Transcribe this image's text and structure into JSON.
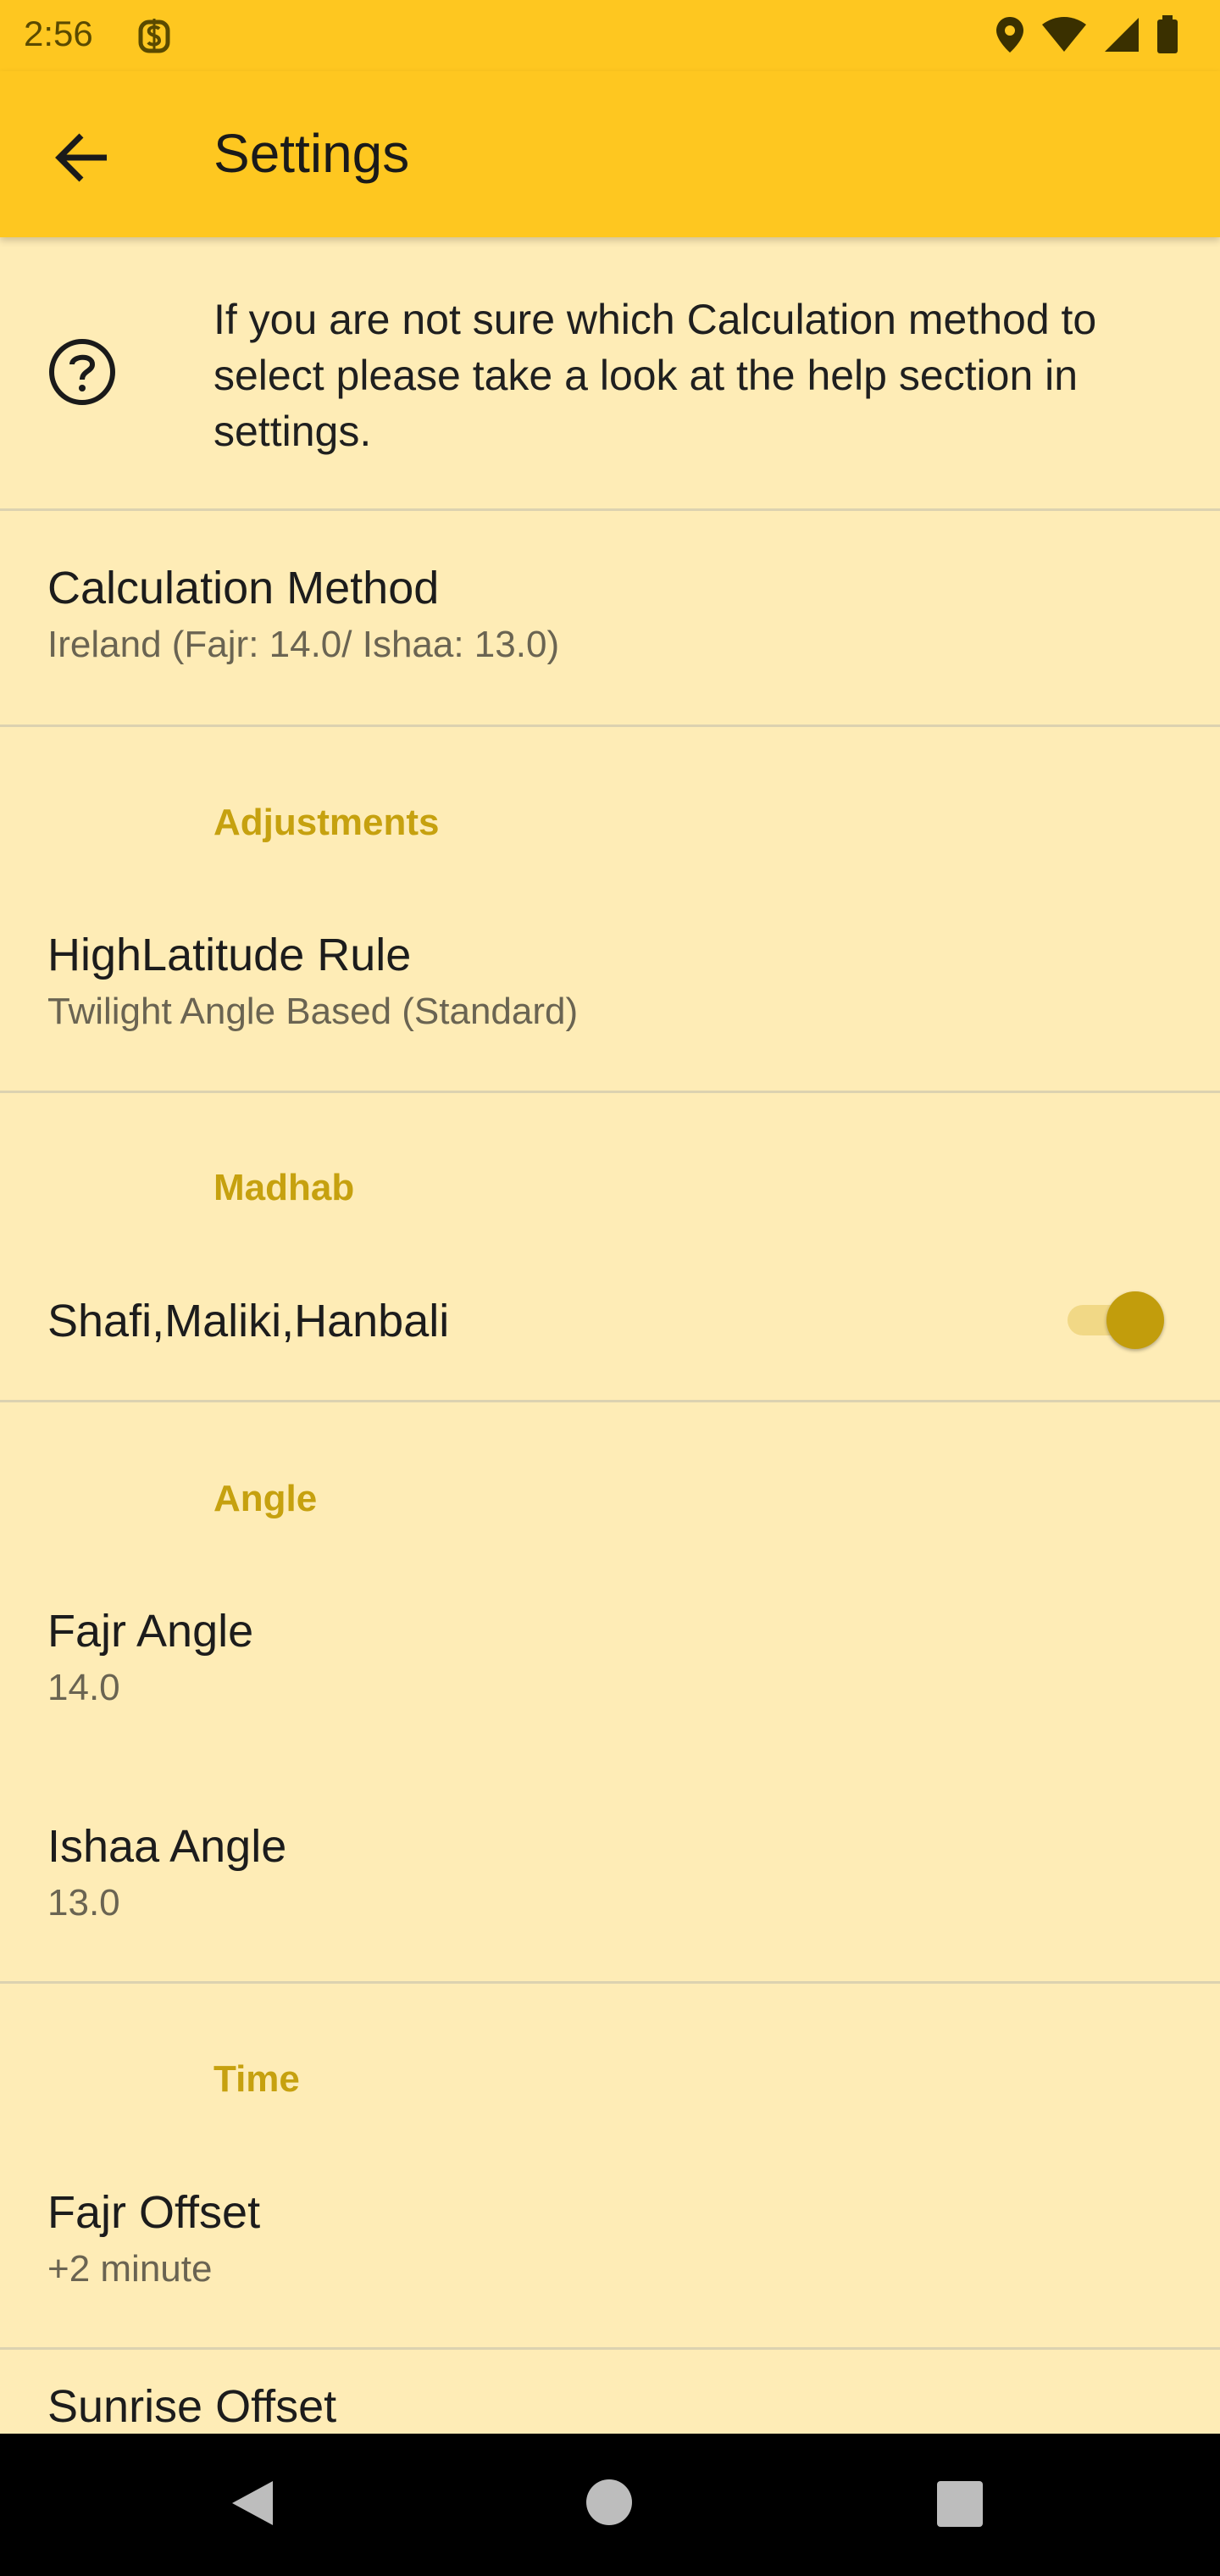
{
  "status_bar": {
    "time": "2:56"
  },
  "app_bar": {
    "title": "Settings",
    "back_icon": "arrow-back-icon"
  },
  "help": {
    "icon": "help-circle-icon",
    "text": "If you are not sure which Calculation method to select please take a look at the help section in settings."
  },
  "calculation_method": {
    "title": "Calculation Method",
    "summary": "Ireland (Fajr: 14.0/ Ishaa: 13.0)"
  },
  "adjustments": {
    "header": "Adjustments",
    "high_latitude": {
      "title": "HighLatitude Rule",
      "summary": "Twilight Angle Based (Standard)"
    }
  },
  "madhab": {
    "header": "Madhab",
    "toggle": {
      "title": "Shafi,Maliki,Hanbali",
      "checked": true
    }
  },
  "angle": {
    "header": "Angle",
    "fajr": {
      "title": "Fajr Angle",
      "summary": "14.0"
    },
    "ishaa": {
      "title": "Ishaa Angle",
      "summary": "13.0"
    }
  },
  "time": {
    "header": "Time",
    "fajr_offset": {
      "title": "Fajr Offset",
      "summary": "+2 minute"
    },
    "sunrise_offset": {
      "title": "Sunrise Offset"
    }
  },
  "colors": {
    "app_bar": "#FEC720",
    "background": "#FEECB6",
    "accent": "#C6A10F"
  }
}
